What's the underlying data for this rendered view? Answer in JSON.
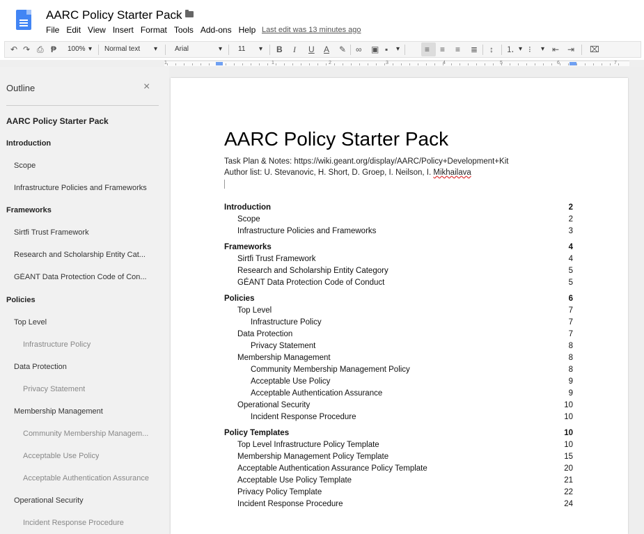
{
  "app": {
    "title": "AARC Policy Starter Pack",
    "menu": [
      "File",
      "Edit",
      "View",
      "Insert",
      "Format",
      "Tools",
      "Add-ons",
      "Help"
    ],
    "last_edit": "Last edit was 13 minutes ago",
    "star_icon": "star-outline-icon",
    "folder_icon": "folder-icon"
  },
  "toolbar": {
    "zoom": "100%",
    "style": "Normal text",
    "font": "Arial",
    "size": "11",
    "icons": [
      "undo-icon",
      "redo-icon",
      "print-icon",
      "paint-format-icon",
      "bold-icon",
      "italic-icon",
      "underline-icon",
      "text-color-icon",
      "highlight-icon",
      "link-icon",
      "comment-icon",
      "image-icon",
      "align-left-icon",
      "align-center-icon",
      "align-right-icon",
      "justify-icon",
      "line-spacing-icon",
      "numbered-list-icon",
      "bulleted-list-icon",
      "decrease-indent-icon",
      "increase-indent-icon",
      "clear-formatting-icon"
    ]
  },
  "ruler": {
    "numbers": [
      "1",
      "1",
      "2",
      "3",
      "4",
      "5",
      "6",
      "7"
    ]
  },
  "outline": {
    "heading": "Outline",
    "close": "×",
    "items": [
      {
        "label": "AARC Policy Starter Pack",
        "level": "title"
      },
      {
        "label": "Introduction",
        "level": "h1"
      },
      {
        "label": "Scope",
        "level": "h2"
      },
      {
        "label": "Infrastructure Policies and Frameworks",
        "level": "h2"
      },
      {
        "label": "Frameworks",
        "level": "h1"
      },
      {
        "label": "Sirtfi Trust Framework",
        "level": "h2"
      },
      {
        "label": "Research and Scholarship Entity Cat...",
        "level": "h2"
      },
      {
        "label": "GÉANT Data Protection Code of Con...",
        "level": "h2"
      },
      {
        "label": "Policies",
        "level": "h1"
      },
      {
        "label": "Top Level",
        "level": "h2"
      },
      {
        "label": "Infrastructure Policy",
        "level": "h3"
      },
      {
        "label": "Data Protection",
        "level": "h2"
      },
      {
        "label": "Privacy Statement",
        "level": "h3"
      },
      {
        "label": "Membership Management",
        "level": "h2"
      },
      {
        "label": "Community Membership Managem...",
        "level": "h3"
      },
      {
        "label": "Acceptable Use Policy",
        "level": "h3"
      },
      {
        "label": "Acceptable Authentication Assurance",
        "level": "h3"
      },
      {
        "label": "Operational Security",
        "level": "h2"
      },
      {
        "label": "Incident Response Procedure",
        "level": "h3"
      }
    ]
  },
  "document": {
    "title": "AARC Policy Starter Pack",
    "task_plan": "Task Plan & Notes: https://wiki.geant.org/display/AARC/Policy+Development+Kit",
    "author_prefix": "Author list: U. Stevanovic, H. Short, D. Groep, I. Neilson, I. ",
    "author_last": "Mikhailava",
    "toc": [
      {
        "text": "Introduction",
        "page": "2",
        "level": "h1"
      },
      {
        "text": "Scope",
        "page": "2",
        "level": "h2"
      },
      {
        "text": "Infrastructure Policies and Frameworks",
        "page": "3",
        "level": "h2"
      },
      {
        "text": "Frameworks",
        "page": "4",
        "level": "h1"
      },
      {
        "text": "Sirtfi Trust Framework",
        "page": "4",
        "level": "h2"
      },
      {
        "text": "Research and Scholarship Entity Category",
        "page": "5",
        "level": "h2"
      },
      {
        "text": "GÉANT Data Protection Code of Conduct",
        "page": "5",
        "level": "h2"
      },
      {
        "text": "Policies",
        "page": "6",
        "level": "h1"
      },
      {
        "text": "Top Level",
        "page": "7",
        "level": "h2"
      },
      {
        "text": "Infrastructure Policy",
        "page": "7",
        "level": "h3"
      },
      {
        "text": "Data Protection",
        "page": "7",
        "level": "h2"
      },
      {
        "text": "Privacy Statement",
        "page": "8",
        "level": "h3"
      },
      {
        "text": "Membership Management",
        "page": "8",
        "level": "h2"
      },
      {
        "text": "Community Membership Management Policy",
        "page": "8",
        "level": "h3"
      },
      {
        "text": "Acceptable Use Policy",
        "page": "9",
        "level": "h3"
      },
      {
        "text": "Acceptable Authentication Assurance",
        "page": "9",
        "level": "h3"
      },
      {
        "text": "Operational Security",
        "page": "10",
        "level": "h2"
      },
      {
        "text": "Incident Response Procedure",
        "page": "10",
        "level": "h3"
      },
      {
        "text": "Policy Templates",
        "page": "10",
        "level": "h1"
      },
      {
        "text": "Top Level Infrastructure Policy Template",
        "page": "10",
        "level": "h2"
      },
      {
        "text": "Membership Management Policy Template",
        "page": "15",
        "level": "h2"
      },
      {
        "text": "Acceptable Authentication Assurance Policy Template",
        "page": "20",
        "level": "h2"
      },
      {
        "text": "Acceptable Use Policy Template",
        "page": "21",
        "level": "h2"
      },
      {
        "text": "Privacy Policy Template",
        "page": "22",
        "level": "h2"
      },
      {
        "text": "Incident Response Procedure",
        "page": "24",
        "level": "h2"
      }
    ]
  }
}
